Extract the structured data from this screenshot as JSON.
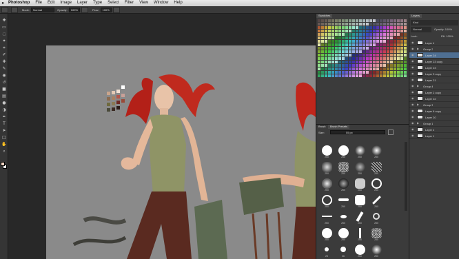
{
  "menubar": {
    "items": [
      "Photoshop",
      "File",
      "Edit",
      "Image",
      "Layer",
      "Type",
      "Select",
      "Filter",
      "View",
      "Window",
      "Help"
    ]
  },
  "options": {
    "mode_label": "Mode:",
    "mode_value": "Normal",
    "opacity_label": "Opacity:",
    "opacity_value": "100%",
    "flow_label": "Flow:",
    "flow_value": "100%"
  },
  "colors": {
    "foreground": "#f2d4c2",
    "background": "#ffffff",
    "canvas": "#8a8a8a",
    "selection": "#4f6f92"
  },
  "tools": [
    "move-icon",
    "marquee-icon",
    "lasso-icon",
    "quick-select-icon",
    "crop-icon",
    "eyedropper-icon",
    "healing-icon",
    "brush-icon",
    "clone-stamp-icon",
    "history-brush-icon",
    "eraser-icon",
    "gradient-icon",
    "blur-icon",
    "dodge-icon",
    "pen-icon",
    "type-icon",
    "path-select-icon",
    "shape-icon",
    "hand-icon",
    "zoom-icon"
  ],
  "swatches_panel": {
    "tab": "Swatches"
  },
  "brush_panel": {
    "tabs": [
      "Brush",
      "Brush Presets"
    ],
    "size_label": "Size:",
    "size_value": "55 px",
    "brush_sizes": [
      "250",
      "250",
      "250",
      "250",
      "250",
      "250",
      "250",
      "250",
      "250",
      "250",
      "250",
      "250",
      "250",
      "250",
      "250",
      "250",
      "250",
      "250",
      "250",
      "250",
      "250",
      "250",
      "250",
      "250",
      "25",
      "36",
      "250",
      "250"
    ]
  },
  "layers_panel": {
    "tab": "Layers",
    "kind_label": "Kind",
    "blend_mode": "Normal",
    "opacity_label": "Opacity:",
    "opacity_value": "100%",
    "lock_label": "Lock:",
    "fill_label": "Fill:",
    "fill_value": "100%",
    "layers": [
      {
        "name": "Layer 4",
        "type": "layer"
      },
      {
        "name": "Group 2",
        "type": "group"
      },
      {
        "name": "Layer 24",
        "type": "layer",
        "selected": true
      },
      {
        "name": "Layer 23 copy",
        "type": "layer"
      },
      {
        "name": "Layer 23",
        "type": "layer"
      },
      {
        "name": "Layer 3 copy",
        "type": "layer"
      },
      {
        "name": "Layer 21",
        "type": "layer"
      },
      {
        "name": "Group 4",
        "type": "group"
      },
      {
        "name": "Layer 2 copy",
        "type": "layer"
      },
      {
        "name": "Layer 22",
        "type": "layer"
      },
      {
        "name": "Group 3",
        "type": "group"
      },
      {
        "name": "Layer 6 copy",
        "type": "layer"
      },
      {
        "name": "Layer 20",
        "type": "layer"
      },
      {
        "name": "Group 1",
        "type": "group"
      },
      {
        "name": "Layer 2",
        "type": "layer"
      },
      {
        "name": "Layer 1",
        "type": "layer"
      }
    ]
  }
}
